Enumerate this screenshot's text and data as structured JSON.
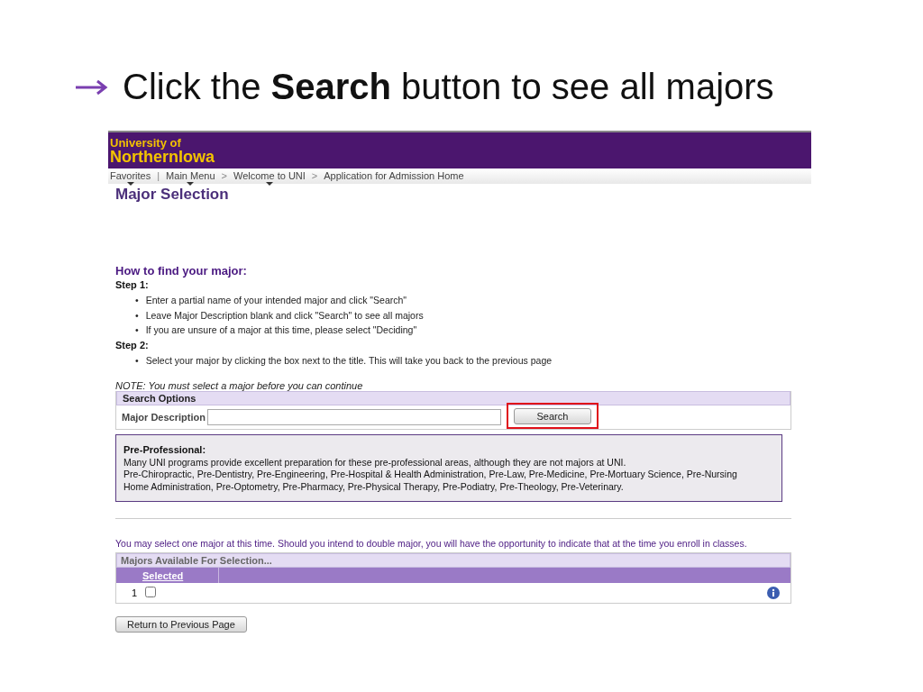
{
  "slide": {
    "title": "Click the **Search** button to see all majors"
  },
  "header": {
    "logo_line_1": "University of",
    "logo_line_2": "NorthernIowa"
  },
  "breadcrumbs": [
    {
      "label": "Favorites",
      "menu": true,
      "separator": "|"
    },
    {
      "label": "Main Menu",
      "menu": true,
      "separator": ">"
    },
    {
      "label": "Welcome to UNI",
      "menu": true,
      "separator": ">"
    },
    {
      "label": "Application for Admission Home",
      "menu": false
    }
  ],
  "page_title": "Major Selection",
  "help": {
    "heading": "How to find your major:",
    "bullet": "•",
    "steps": [
      {
        "label": "Step 1:",
        "bullets": [
          "Enter a partial name of your intended major and click \"Search\"",
          "Leave Major Description blank and click \"Search\" to see all majors",
          "If you are unsure of a major at this time, please select \"Deciding\""
        ]
      },
      {
        "label": "Step 2:",
        "bullets": [
          "Select your major by clicking the box next to the title. This will take you back to the previous page"
        ]
      }
    ],
    "note": "NOTE: You must select a major before you can continue"
  },
  "search_options": {
    "title": "Search Options",
    "field_label": "Major Description",
    "button": "Search",
    "highlighted": true
  },
  "pre_professional": {
    "heading": "Pre-Professional:",
    "lines": [
      "Many UNI programs provide excellent preparation for these pre-professional areas, although they are not majors at UNI.",
      "Pre-Chiropractic, Pre-Dentistry, Pre-Engineering, Pre-Hospital & Health Administration, Pre-Law, Pre-Medicine, Pre-Mortuary Science, Pre-Nursing Home Administration, Pre-Optometry, Pre-Pharmacy, Pre-Physical Therapy, Pre-Podiatry, Pre-Theology, Pre-Veterinary."
    ]
  },
  "intro": "You may select one major at this time. Should you intend to double major, you will have the opportunity to indicate that at the time you enroll in classes.",
  "grid": {
    "title": "Majors Available For Selection...",
    "column_header": "Selected",
    "rows": [
      {
        "number": "1",
        "checked": false
      }
    ]
  },
  "return_button": "Return to Previous Page"
}
